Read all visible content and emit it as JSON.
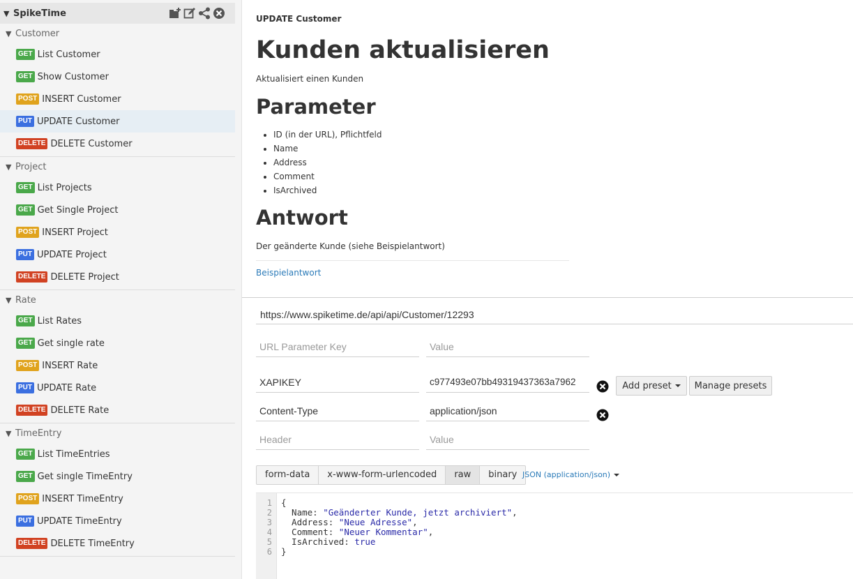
{
  "collection": {
    "name": "SpikeTime",
    "icons": [
      "folder-add-icon",
      "edit-icon",
      "share-icon",
      "close-circle-icon"
    ]
  },
  "folders": [
    {
      "name": "Customer",
      "requests": [
        {
          "method": "GET",
          "name": "List Customer"
        },
        {
          "method": "GET",
          "name": "Show Customer"
        },
        {
          "method": "POST",
          "name": "INSERT Customer"
        },
        {
          "method": "PUT",
          "name": "UPDATE Customer"
        },
        {
          "method": "DELETE",
          "name": "DELETE Customer"
        }
      ]
    },
    {
      "name": "Project",
      "requests": [
        {
          "method": "GET",
          "name": "List Projects"
        },
        {
          "method": "GET",
          "name": "Get Single Project"
        },
        {
          "method": "POST",
          "name": "INSERT Project"
        },
        {
          "method": "PUT",
          "name": "UPDATE Project"
        },
        {
          "method": "DELETE",
          "name": "DELETE Project"
        }
      ]
    },
    {
      "name": "Rate",
      "requests": [
        {
          "method": "GET",
          "name": "List Rates"
        },
        {
          "method": "GET",
          "name": "Get single rate"
        },
        {
          "method": "POST",
          "name": "INSERT Rate"
        },
        {
          "method": "PUT",
          "name": "UPDATE Rate"
        },
        {
          "method": "DELETE",
          "name": "DELETE Rate"
        }
      ]
    },
    {
      "name": "TimeEntry",
      "requests": [
        {
          "method": "GET",
          "name": "List TimeEntries"
        },
        {
          "method": "GET",
          "name": "Get single TimeEntry"
        },
        {
          "method": "POST",
          "name": "INSERT TimeEntry"
        },
        {
          "method": "PUT",
          "name": "UPDATE TimeEntry"
        },
        {
          "method": "DELETE",
          "name": "DELETE TimeEntry"
        }
      ]
    }
  ],
  "active_request": "UPDATE Customer",
  "doc": {
    "label": "UPDATE Customer",
    "title": "Kunden aktualisieren",
    "description": "Aktualisiert einen Kunden",
    "params_heading": "Parameter",
    "params": [
      "ID (in der URL), Pflichtfeld",
      "Name",
      "Address",
      "Comment",
      "IsArchived"
    ],
    "answer_heading": "Antwort",
    "answer_text": "Der geänderte Kunde (siehe Beispielantwort)",
    "example_link": "Beispielantwort"
  },
  "request": {
    "url": "https://www.spiketime.de/api/api/Customer/12293",
    "url_param_key_placeholder": "URL Parameter Key",
    "url_param_value_placeholder": "Value",
    "headers": [
      {
        "key": "XAPIKEY",
        "value": "c977493e07bb49319437363a7962"
      },
      {
        "key": "Content-Type",
        "value": "application/json"
      }
    ],
    "header_key_placeholder": "Header",
    "header_value_placeholder": "Value",
    "add_preset_label": "Add preset",
    "manage_presets_label": "Manage presets",
    "body_tabs": [
      "form-data",
      "x-www-form-urlencoded",
      "raw",
      "binary"
    ],
    "active_body_tab": "raw",
    "body_mode": "JSON (application/json)",
    "body_lines": [
      "{",
      "  Name: \"Geänderter Kunde, jetzt archiviert\",",
      "  Address: \"Neue Adresse\",",
      "  Comment: \"Neuer Kommentar\",",
      "  IsArchived: true",
      "}"
    ]
  }
}
